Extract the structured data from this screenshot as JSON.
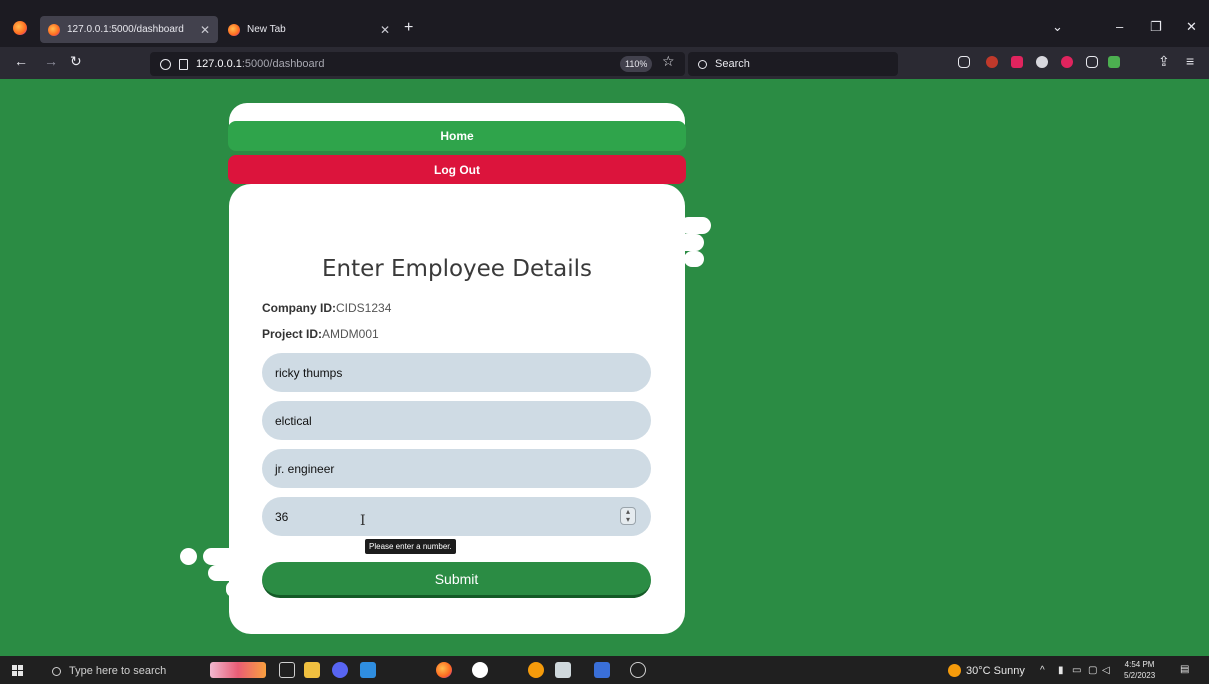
{
  "browser": {
    "tabs": [
      {
        "label": "127.0.0.1:5000/dashboard",
        "active": true
      },
      {
        "label": "New Tab",
        "active": false
      }
    ],
    "url_host": "127.0.0.1",
    "url_path": ":5000/dashboard",
    "zoom": "110%",
    "search_placeholder": "Search"
  },
  "page": {
    "nav": {
      "home": "Home",
      "logout": "Log Out"
    },
    "title": "Enter Employee Details",
    "company_label": "Company ID:",
    "company_value": "CIDS1234",
    "project_label": "Project ID:",
    "project_value": "AMDM001",
    "fields": {
      "name": "ricky thumps",
      "department": "elctical",
      "designation": "jr. engineer",
      "age": "36"
    },
    "tooltip": "Please enter a number.",
    "submit": "Submit"
  },
  "taskbar": {
    "search_placeholder": "Type here to search",
    "weather": "30°C  Sunny",
    "time": "4:54 PM",
    "date": "5/2/2023"
  },
  "colors": {
    "page_bg": "#2b8c44",
    "home_btn": "#2fa44b",
    "logout_btn": "#dc143c",
    "input_bg": "#cfdbe4"
  }
}
